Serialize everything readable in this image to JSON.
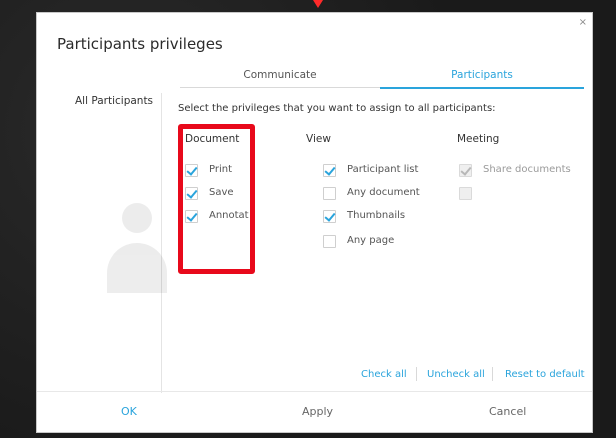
{
  "dialog": {
    "title": "Participants privileges",
    "close_glyph": "×"
  },
  "sidebar": {
    "items": [
      {
        "label": "All Participants"
      }
    ]
  },
  "tabs": [
    {
      "label": "Communicate",
      "active": false
    },
    {
      "label": "Participants",
      "active": true
    }
  ],
  "prompt": "Select the privileges that you want to assign to all participants:",
  "columns": {
    "document": {
      "header": "Document",
      "options": [
        {
          "label": "Print",
          "checked": true,
          "enabled": true
        },
        {
          "label": "Save",
          "checked": true,
          "enabled": true
        },
        {
          "label": "Annotat",
          "checked": true,
          "enabled": true
        }
      ]
    },
    "view": {
      "header": "View",
      "options": [
        {
          "label": "Participant list",
          "checked": true,
          "enabled": true
        },
        {
          "label": "Any document",
          "checked": false,
          "enabled": true
        },
        {
          "label": "Thumbnails",
          "checked": true,
          "enabled": true
        },
        {
          "label": "Any page",
          "checked": false,
          "enabled": true
        }
      ]
    },
    "meeting": {
      "header": "Meeting",
      "options": [
        {
          "label": "Share documents",
          "checked": true,
          "enabled": false
        },
        {
          "label": "",
          "checked": false,
          "enabled": false
        }
      ]
    }
  },
  "actions": {
    "check_all": "Check all",
    "uncheck_all": "Uncheck all",
    "reset_default": "Reset to default"
  },
  "footer": {
    "ok": "OK",
    "apply": "Apply",
    "cancel": "Cancel"
  },
  "colors": {
    "accent": "#2aa4dc",
    "highlight": "#e8091b"
  },
  "icons": {
    "close": "close-icon",
    "user_placeholder": "user-silhouette-icon",
    "checkbox": "checkmark-icon"
  }
}
